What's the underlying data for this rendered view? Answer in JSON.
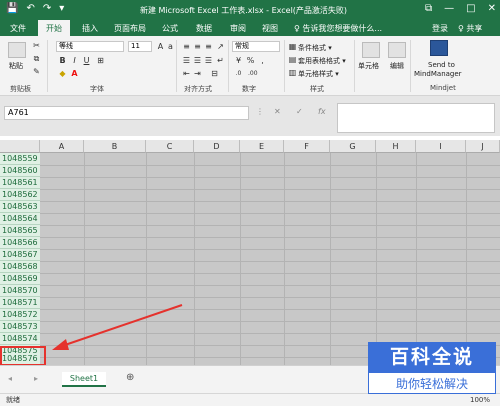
{
  "titlebar": {
    "title": "新建 Microsoft Excel 工作表.xlsx - Excel(产品激活失败)",
    "qa_save": "💾",
    "qa_undo": "↶",
    "qa_redo": "↷",
    "qa_more": "▾",
    "restore_icon": "⧉",
    "minimize": "—",
    "maximize": "□",
    "close": "✕"
  },
  "tabs": [
    {
      "label": "文件"
    },
    {
      "label": "开始"
    },
    {
      "label": "插入"
    },
    {
      "label": "页面布局"
    },
    {
      "label": "公式"
    },
    {
      "label": "数据"
    },
    {
      "label": "审阅"
    },
    {
      "label": "视图"
    }
  ],
  "tellme": "♀ 告诉我您想要做什么...",
  "login": "登录",
  "share": "♀ 共享",
  "ribbon": {
    "paste": "粘贴",
    "clipboard": "剪贴板",
    "font_name": "等线",
    "font_size": "11",
    "font": "字体",
    "align": "对齐方式",
    "number_format": "常规",
    "number": "数字",
    "cond_format": "条件格式 ▾",
    "table_format": "套用表格格式 ▾",
    "cell_style": "单元格样式 ▾",
    "styles": "样式",
    "cells": "单元格",
    "editing": "编辑",
    "send_to": "Send to",
    "mindmanager": "MindManager",
    "mindjet": "Mindjet",
    "bold": "B",
    "italic": "I",
    "underline": "U",
    "font_color": "A",
    "currency": "¥",
    "percent": "%",
    "comma": ","
  },
  "formula_bar": {
    "name_box": "A761",
    "cancel": "✕",
    "confirm": "✓",
    "fx": "fx"
  },
  "columns": [
    "A",
    "B",
    "C",
    "D",
    "E",
    "F",
    "G",
    "H",
    "I",
    "J"
  ],
  "rows": [
    "1048559",
    "1048560",
    "1048561",
    "1048562",
    "1048563",
    "1048564",
    "1048565",
    "1048566",
    "1048567",
    "1048568",
    "1048569",
    "1048570",
    "1048571",
    "1048572",
    "1048573",
    "1048574",
    "1048575",
    "1048576"
  ],
  "sheet": {
    "name": "Sheet1",
    "add": "⊕",
    "nav_prev": "◂",
    "nav_next": "▸"
  },
  "status": {
    "ready": "就绪",
    "zoom": "100%"
  },
  "watermark": {
    "top": "百科全说",
    "bottom": "助你轻松解决"
  },
  "colors": {
    "excel_green": "#217346",
    "highlight_red": "#e5322d",
    "watermark_blue": "#3a6fd8"
  }
}
